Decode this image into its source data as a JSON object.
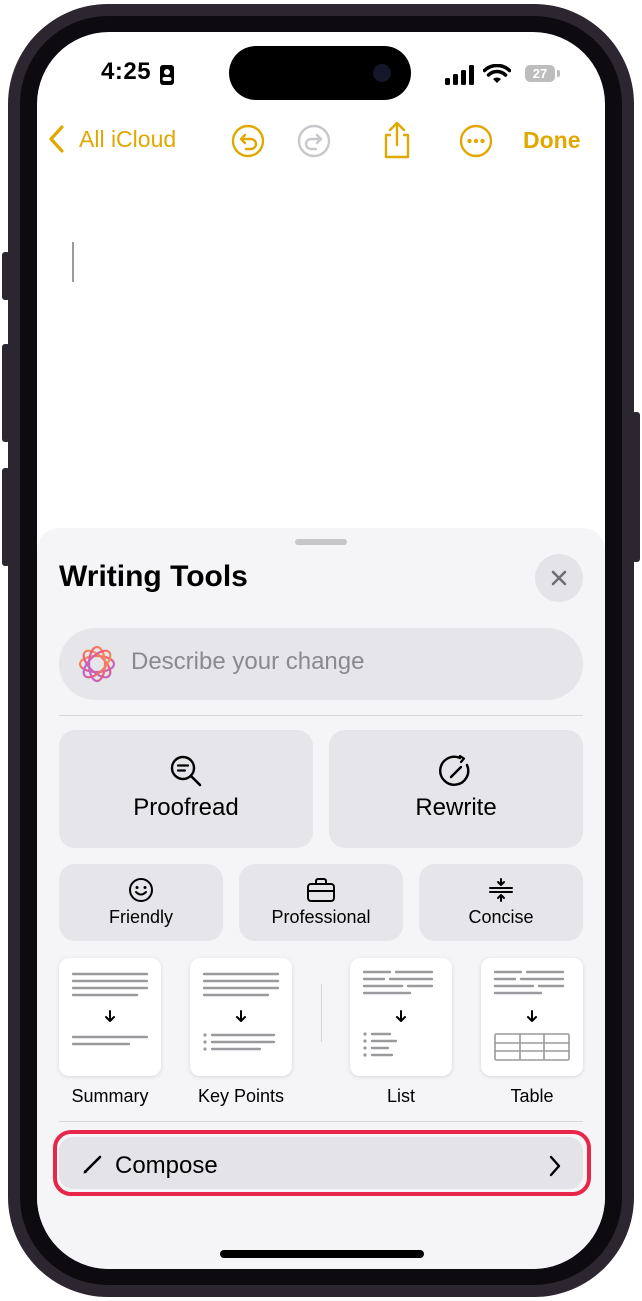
{
  "status_bar": {
    "time": "4:25",
    "battery": "27"
  },
  "toolbar": {
    "back_label": "All iCloud",
    "done_label": "Done"
  },
  "writing_tools": {
    "title": "Writing Tools",
    "describe_placeholder": "Describe your change",
    "primary_actions": [
      {
        "label": "Proofread",
        "icon": "magnifier-check-icon"
      },
      {
        "label": "Rewrite",
        "icon": "rewrite-icon"
      }
    ],
    "tone_actions": [
      {
        "label": "Friendly",
        "icon": "smiley-icon"
      },
      {
        "label": "Professional",
        "icon": "briefcase-icon"
      },
      {
        "label": "Concise",
        "icon": "concise-icon"
      }
    ],
    "format_actions": [
      {
        "label": "Summary"
      },
      {
        "label": "Key Points"
      },
      {
        "label": "List"
      },
      {
        "label": "Table"
      }
    ],
    "compose_label": "Compose"
  },
  "colors": {
    "accent": "#e0a800",
    "highlight_ring": "#e8264a",
    "sheet_bg": "#f5f5f7",
    "tile_bg": "#e6e6ea"
  }
}
